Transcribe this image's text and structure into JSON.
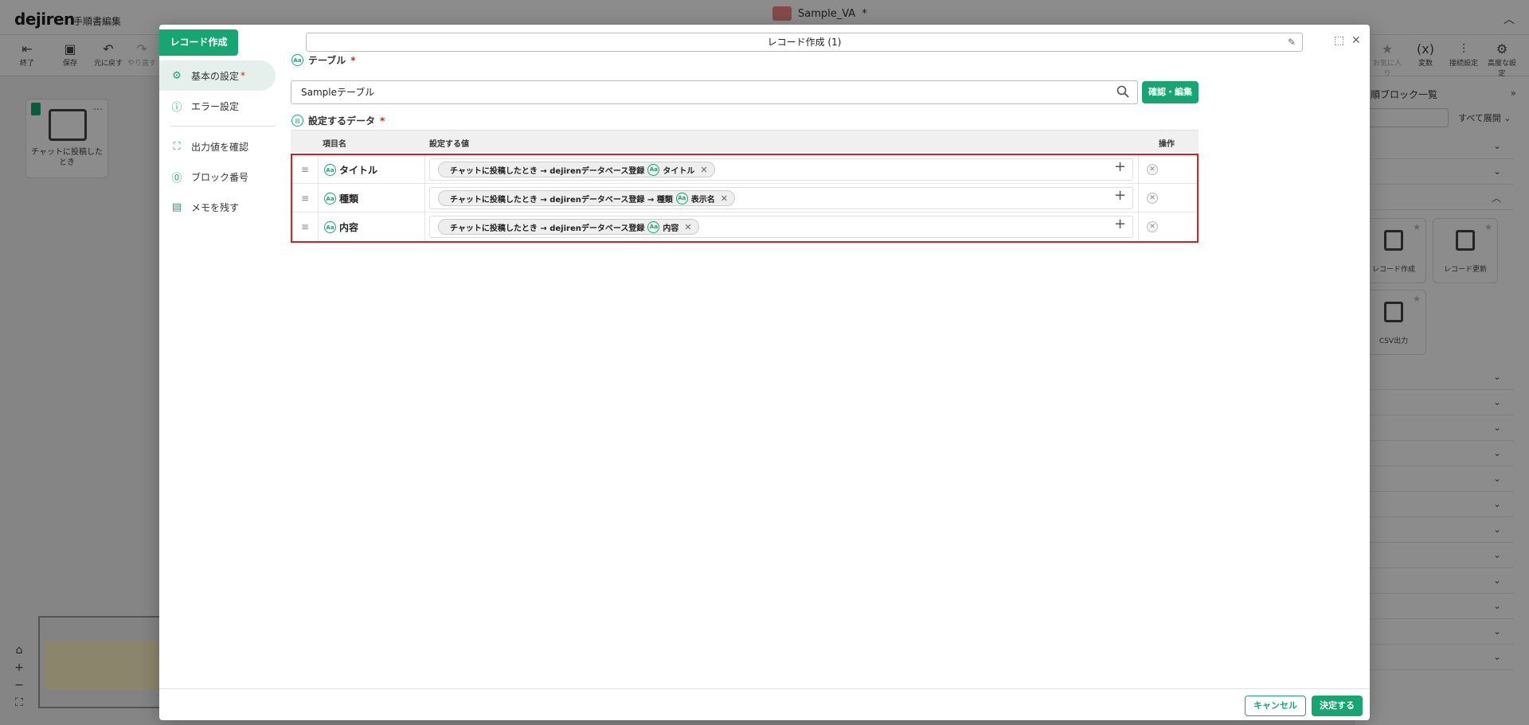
{
  "app": {
    "logo": "dejiren",
    "subtitle": "手順書編集",
    "doc_title": "Sample_VA",
    "doc_modified_mark": "*",
    "toolbar": [
      {
        "label": "終了",
        "icon": "exit-icon"
      },
      {
        "label": "保存",
        "icon": "save-icon"
      },
      {
        "label": "元に戻す",
        "icon": "undo-icon"
      },
      {
        "label": "やり直す",
        "icon": "redo-icon"
      }
    ],
    "toolbar_right": [
      {
        "label": "お気に入り",
        "icon": "star-icon"
      },
      {
        "label": "変数",
        "icon": "variable-icon"
      },
      {
        "label": "接続設定",
        "icon": "connection-settings-icon"
      },
      {
        "label": "高度な設定",
        "icon": "advanced-settings-icon"
      }
    ],
    "canvas_block_label": "チャットに投稿したとき",
    "right_panel": {
      "title": "順ブロック一覧",
      "expand_all": "すべて展開",
      "cards": [
        {
          "label": "レコード作成"
        },
        {
          "label": "レコード更新"
        },
        {
          "label": "CSV出力"
        }
      ]
    }
  },
  "modal": {
    "badge": "レコード作成",
    "title": "レコード作成 (1)",
    "side_nav": [
      {
        "label": "基本の設定",
        "required": "*",
        "icon": "gear-icon",
        "active": true
      },
      {
        "label": "エラー設定",
        "required": "",
        "icon": "error-icon",
        "active": false
      },
      {
        "label": "出力値を確認",
        "required": "",
        "icon": "output-icon",
        "active": false
      },
      {
        "label": "ブロック番号",
        "required": "",
        "icon": "block-number-icon",
        "active": false
      },
      {
        "label": "メモを残す",
        "required": "",
        "icon": "memo-icon",
        "active": false
      }
    ],
    "table_section": {
      "label": "テーブル",
      "required": "*",
      "value": "Sampleテーブル",
      "confirm_button": "確認・編集"
    },
    "data_section": {
      "label": "設定するデータ",
      "required": "*",
      "columns": {
        "name": "項目名",
        "value": "設定する値",
        "action": "操作"
      },
      "rows": [
        {
          "name": "タイトル",
          "chip_path": "チャットに投稿したとき → dejirenデータベース登録",
          "chip_field": "タイトル"
        },
        {
          "name": "種類",
          "chip_path": "チャットに投稿したとき → dejirenデータベース登録 → 種類",
          "chip_field": "表示名"
        },
        {
          "name": "内容",
          "chip_path": "チャットに投稿したとき → dejirenデータベース登録",
          "chip_field": "内容"
        }
      ]
    },
    "footer": {
      "cancel": "キャンセル",
      "submit": "決定する"
    }
  }
}
